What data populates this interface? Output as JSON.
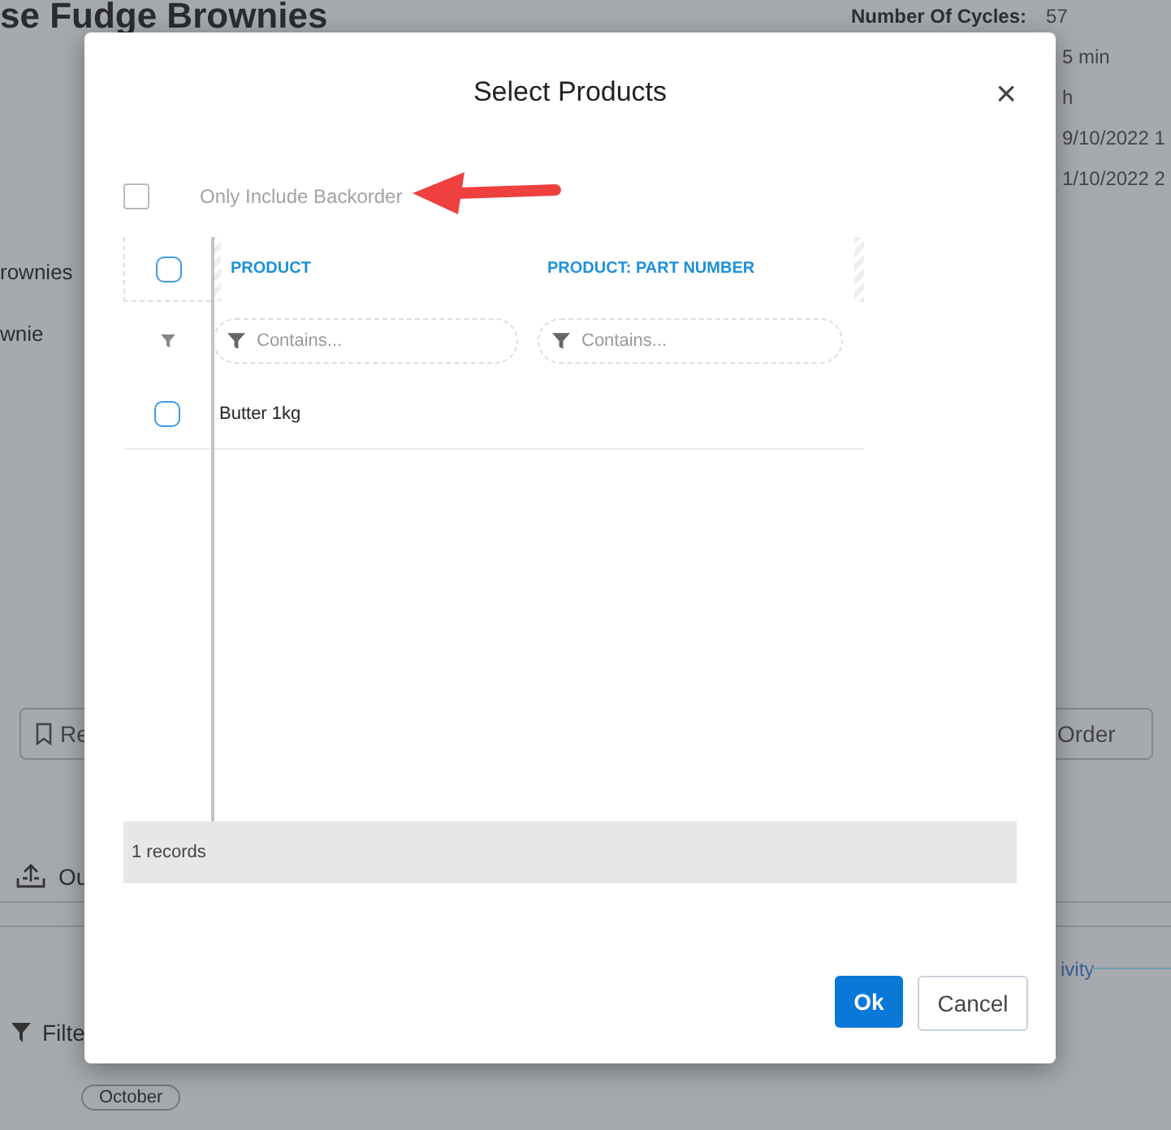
{
  "background": {
    "title": "se Fudge Brownies",
    "details": [
      {
        "label": "Number Of Cycles:",
        "value": "57"
      },
      {
        "value": "5 min"
      },
      {
        "value": "h"
      },
      {
        "value": "9/10/2022 1"
      },
      {
        "value": "1/10/2022 2"
      }
    ],
    "list_items": [
      "rownies",
      "wnie"
    ],
    "buttons": [
      {
        "label": "Re"
      },
      {
        "label": "Order"
      }
    ],
    "action": {
      "label": "Ou"
    },
    "link": "ivity",
    "filter": "Filte",
    "chip": "October"
  },
  "dialog": {
    "title": "Select Products",
    "close": "×",
    "backorder": {
      "label": "Only Include Backorder",
      "checked": false
    },
    "columns": [
      "PRODUCT",
      "PRODUCT: PART NUMBER"
    ],
    "header_checked": false,
    "filters": [
      {
        "placeholder": "Contains..."
      },
      {
        "placeholder": "Contains..."
      }
    ],
    "rows": [
      {
        "cells": [
          "Butter 1kg",
          ""
        ],
        "selected": false
      }
    ],
    "footer": "1 records",
    "buttons": [
      {
        "label": "Ok",
        "kind": "primary"
      },
      {
        "label": "Cancel",
        "kind": "secondary"
      }
    ]
  }
}
